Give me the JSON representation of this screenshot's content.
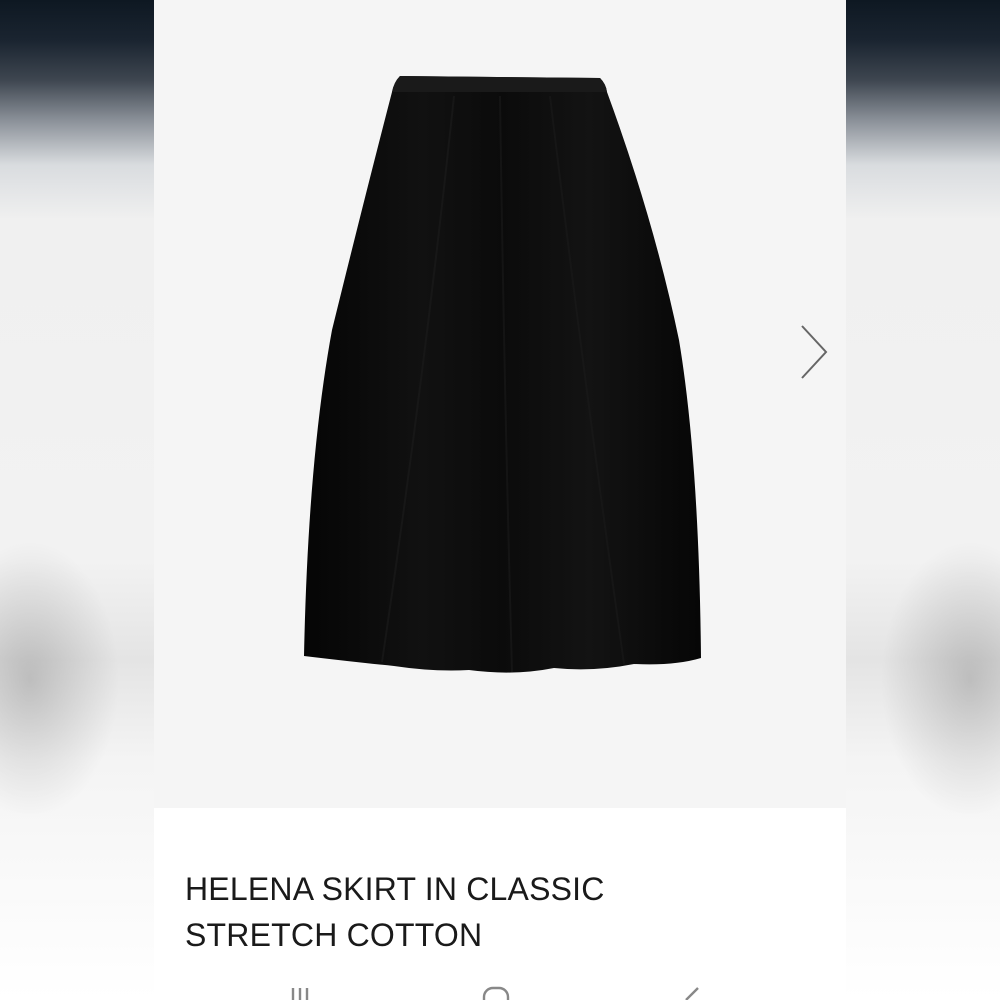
{
  "product": {
    "title_line1": "HELENA SKIRT IN CLASSIC",
    "title_line2": "STRETCH COTTON",
    "color": "#000000"
  },
  "gallery": {
    "next_icon": "chevron-right-icon"
  },
  "system_nav": {
    "recents_icon": "recents-icon",
    "home_icon": "home-icon",
    "back_icon": "back-icon"
  },
  "colors": {
    "image_background": "#f5f5f5",
    "page_background": "#ffffff",
    "text": "#1a1a1a"
  }
}
